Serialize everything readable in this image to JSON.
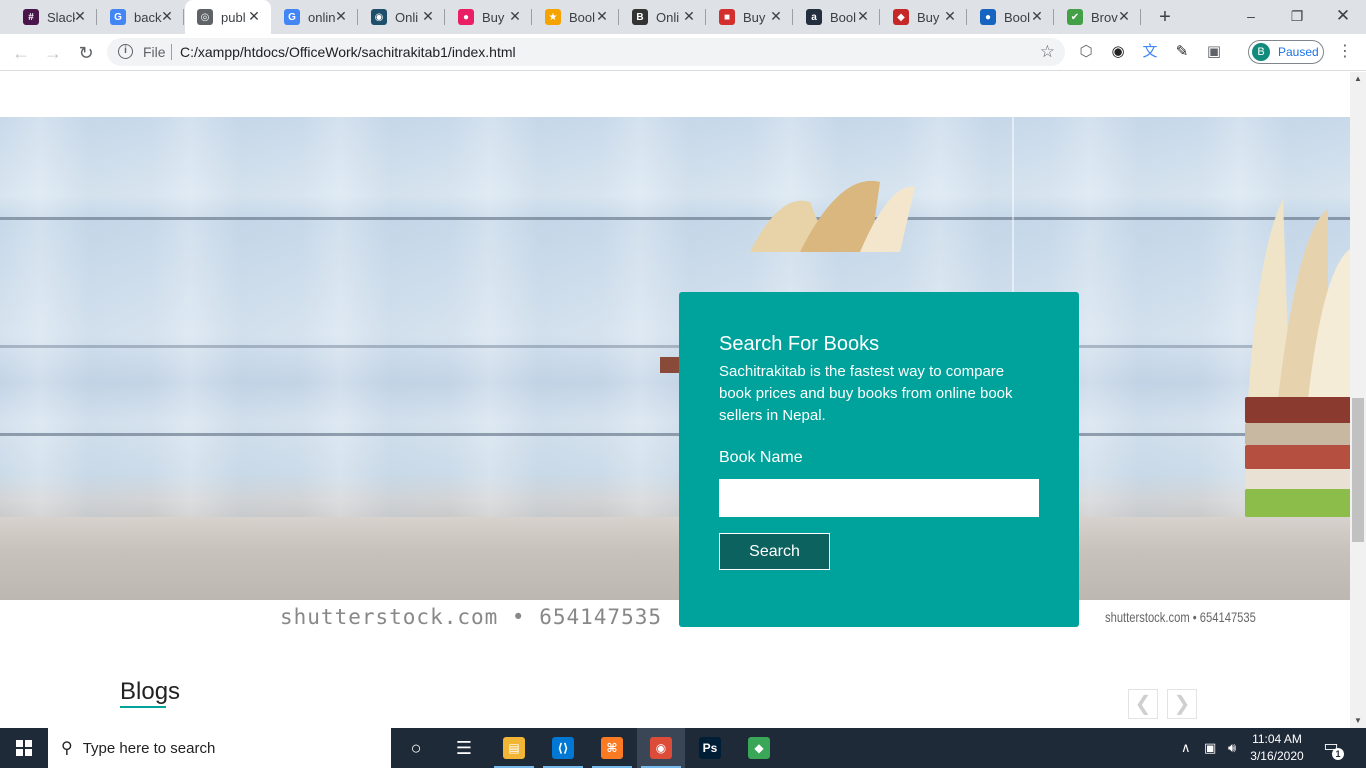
{
  "browser": {
    "tabs": [
      {
        "label": "Slack",
        "icon": "slack-icon",
        "color": "#4a154b",
        "glyph": "#"
      },
      {
        "label": "back",
        "icon": "google-icon",
        "color": "#4285f4",
        "glyph": "G"
      },
      {
        "label": "publ",
        "icon": "globe-icon",
        "color": "#5f6368",
        "glyph": "◎",
        "active": true
      },
      {
        "label": "onlin",
        "icon": "google-icon",
        "color": "#4285f4",
        "glyph": "G"
      },
      {
        "label": "Onli",
        "icon": "site-icon",
        "color": "#1d4e6b",
        "glyph": "◉"
      },
      {
        "label": "Buy",
        "icon": "site-icon",
        "color": "#e91e63",
        "glyph": "●"
      },
      {
        "label": "Bool",
        "icon": "site-icon",
        "color": "#f4a300",
        "glyph": "★"
      },
      {
        "label": "Onli",
        "icon": "bold-b-icon",
        "color": "#333333",
        "glyph": "B"
      },
      {
        "label": "Buy",
        "icon": "site-icon",
        "color": "#d32f2f",
        "glyph": "■"
      },
      {
        "label": "Bool",
        "icon": "amazon-icon",
        "color": "#232f3e",
        "glyph": "a"
      },
      {
        "label": "Buy",
        "icon": "book-icon",
        "color": "#c62828",
        "glyph": "◆"
      },
      {
        "label": "Bool",
        "icon": "site-icon",
        "color": "#1565c0",
        "glyph": "●"
      },
      {
        "label": "Brov",
        "icon": "check-icon",
        "color": "#43a047",
        "glyph": "✔"
      }
    ],
    "address": {
      "scheme": "File",
      "url": "C:/xampp/htdocs/OfficeWork/sachitrakitab1/index.html"
    },
    "profile": {
      "initial": "B",
      "status": "Paused"
    }
  },
  "page": {
    "watermark_main": "shutterstock.com • 654147535",
    "watermark_small": "shutterstock.com • 654147535",
    "search_card": {
      "title": "Search For Books",
      "description": "Sachitrakitab is the fastest way to compare book prices and buy books from online book sellers in Nepal.",
      "field_label": "Book Name",
      "field_value": "",
      "field_placeholder": "",
      "button_label": "Search",
      "bg_color": "#00a39b"
    },
    "blogs": {
      "heading": "Blogs",
      "prev_glyph": "❮",
      "next_glyph": "❯"
    }
  },
  "taskbar": {
    "search_placeholder": "Type here to search",
    "apps": [
      {
        "name": "task-view",
        "glyph": "○"
      },
      {
        "name": "timeline",
        "glyph": "☰"
      },
      {
        "name": "file-explorer",
        "color": "#f2b535",
        "glyph": "▤"
      },
      {
        "name": "vscode",
        "color": "#0078d4",
        "glyph": "⟨⟩"
      },
      {
        "name": "xampp",
        "color": "#fb7a24",
        "glyph": "⌘"
      },
      {
        "name": "chrome",
        "color": "#dd4b39",
        "glyph": "◉"
      },
      {
        "name": "photoshop",
        "color": "#001e36",
        "glyph": "Ps"
      },
      {
        "name": "layers-app",
        "color": "#3aa657",
        "glyph": "◆"
      }
    ],
    "clock_time": "11:04 AM",
    "clock_date": "3/16/2020",
    "notification_count": "1"
  }
}
